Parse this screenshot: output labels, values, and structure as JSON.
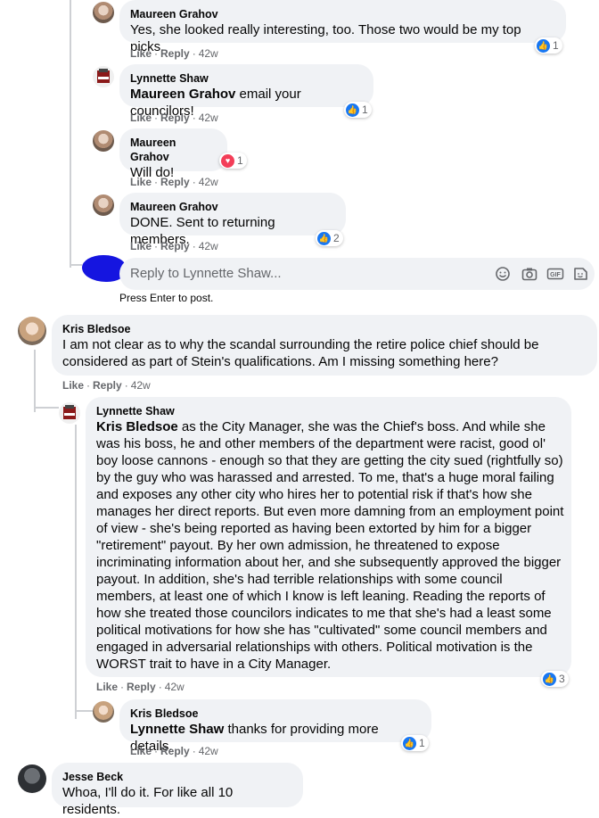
{
  "comments": [
    {
      "author": "Maureen Grahov",
      "mention": "",
      "text": "Yes, she looked really interesting, too. Those two would be my top picks.",
      "like": "Like",
      "reply": "Reply",
      "time": "42w",
      "reaction_count": "1",
      "reaction": "like-icon"
    },
    {
      "author": "Lynnette Shaw",
      "mention": "Maureen Grahov",
      "text": "email your councilors!",
      "like": "Like",
      "reply": "Reply",
      "time": "42w",
      "reaction_count": "1",
      "reaction": "like-icon"
    },
    {
      "author": "Maureen Grahov",
      "mention": "",
      "text": "Will do!",
      "like": "Like",
      "reply": "Reply",
      "time": "42w",
      "reaction_count": "1",
      "reaction": "love-icon"
    },
    {
      "author": "Maureen Grahov",
      "mention": "",
      "text": "DONE. Sent to returning members.",
      "like": "Like",
      "reply": "Reply",
      "time": "42w",
      "reaction_count": "2",
      "reaction": "like-icon"
    },
    {
      "author": "Kris Bledsoe",
      "mention": "",
      "text": "I am not clear as to why the scandal surrounding the retire police chief should be considered as part of Stein's qualifications. Am I missing something here?",
      "like": "Like",
      "reply": "Reply",
      "time": "42w",
      "reaction_count": "",
      "reaction": ""
    },
    {
      "author": "Lynnette Shaw",
      "mention": "Kris Bledsoe",
      "text": "as the City Manager, she was the Chief's boss. And while she was his boss, he and other members of the department were racist, good ol' boy loose cannons - enough so that they are getting the city sued (rightfully so) by the guy who was harassed and arrested. To me, that's a huge moral failing and exposes any other city who hires her to potential risk if that's how she manages her direct reports. But even more damning from an employment point of view - she's being reported as having been extorted by him for a bigger \"retirement\" payout. By her own admission, he threatened to expose incriminating information about her, and she subsequently approved the bigger payout. In addition, she's had terrible relationships with some council members, at least one of which I know is left leaning. Reading the reports of how she treated those councilors indicates to me that she's had a least some political motivations for how she has \"cultivated\" some council members and engaged in adversarial relationships with others. Political motivation is the WORST trait to have in a City Manager.",
      "like": "Like",
      "reply": "Reply",
      "time": "42w",
      "reaction_count": "3",
      "reaction": "like-icon"
    },
    {
      "author": "Kris Bledsoe",
      "mention": "Lynnette Shaw",
      "text": "thanks for providing more details.",
      "like": "Like",
      "reply": "Reply",
      "time": "42w",
      "reaction_count": "1",
      "reaction": "like-icon"
    },
    {
      "author": "Jesse Beck",
      "mention": "",
      "text": "Whoa, I'll do it. For like all 10 residents.",
      "like": "",
      "reply": "",
      "time": "",
      "reaction_count": "",
      "reaction": ""
    }
  ],
  "reply_box": {
    "placeholder": "Reply to Lynnette Shaw...",
    "hint": "Press Enter to post.",
    "icons": [
      "emoji-icon",
      "camera-icon",
      "gif-icon",
      "sticker-icon"
    ]
  },
  "colors": {
    "accent": "#1877f2",
    "love": "#f33e58",
    "bubble": "#f0f2f5",
    "muted": "#65676b"
  }
}
